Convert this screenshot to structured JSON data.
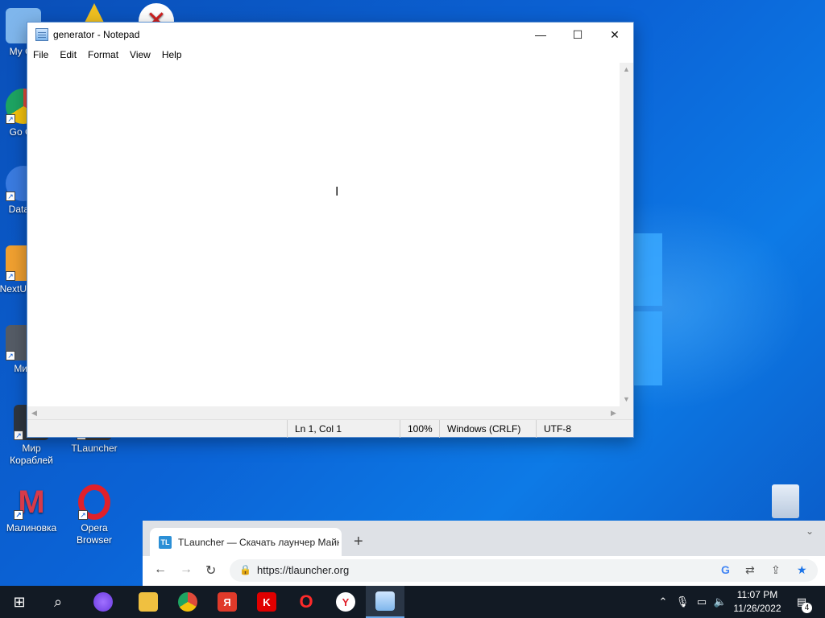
{
  "desktop": {
    "icons": [
      {
        "label": "My Co",
        "color": "#7fb6ec"
      },
      {
        "label": "Go Ch",
        "color": "#e04a3a"
      },
      {
        "label": "DataW",
        "color": "#3a7be0"
      },
      {
        "label": "NextU - Sh",
        "color": "#f0a030"
      },
      {
        "label": "Мир",
        "color": "#555c66"
      },
      {
        "label": "Мир Кораблей",
        "color": "#2e3640"
      },
      {
        "label": "TLauncher",
        "color": "#3a3a3a"
      },
      {
        "label": "Малиновка",
        "color": "#d63a4a"
      },
      {
        "label": "Opera Browser",
        "color": "#e0202a"
      }
    ]
  },
  "notepad": {
    "title": "generator - Notepad",
    "controls": {
      "minimize": "—",
      "maximize": "☐",
      "close": "✕"
    },
    "menu": [
      "File",
      "Edit",
      "Format",
      "View",
      "Help"
    ],
    "content": "",
    "status": {
      "position": "Ln 1, Col 1",
      "zoom": "100%",
      "line_endings": "Windows (CRLF)",
      "encoding": "UTF-8"
    }
  },
  "chrome": {
    "tab_title": "TLauncher — Скачать лаунчер Майнкрафт",
    "favicon": "TL",
    "url": "https://tlauncher.org",
    "icons": {
      "back": "back-arrow-icon",
      "forward": "forward-arrow-icon",
      "reload": "reload-icon",
      "lock": "lock-icon",
      "google": "google-icon",
      "translate": "translate-icon",
      "share": "share-icon",
      "bookmark": "star-icon"
    }
  },
  "taskbar": {
    "apps": [
      {
        "name": "start",
        "glyph": "⊞"
      },
      {
        "name": "search",
        "glyph": "⌕"
      },
      {
        "name": "alice",
        "glyph": ""
      },
      {
        "name": "file-explorer",
        "glyph": ""
      },
      {
        "name": "chrome",
        "glyph": ""
      },
      {
        "name": "yandex",
        "glyph": "Я"
      },
      {
        "name": "kaspersky",
        "glyph": "K"
      },
      {
        "name": "opera",
        "glyph": "O"
      },
      {
        "name": "yandex-browser",
        "glyph": "Y"
      },
      {
        "name": "notepad",
        "glyph": ""
      }
    ],
    "clock": {
      "time": "11:07 PM",
      "date": "11/26/2022"
    },
    "notifications": "4"
  }
}
